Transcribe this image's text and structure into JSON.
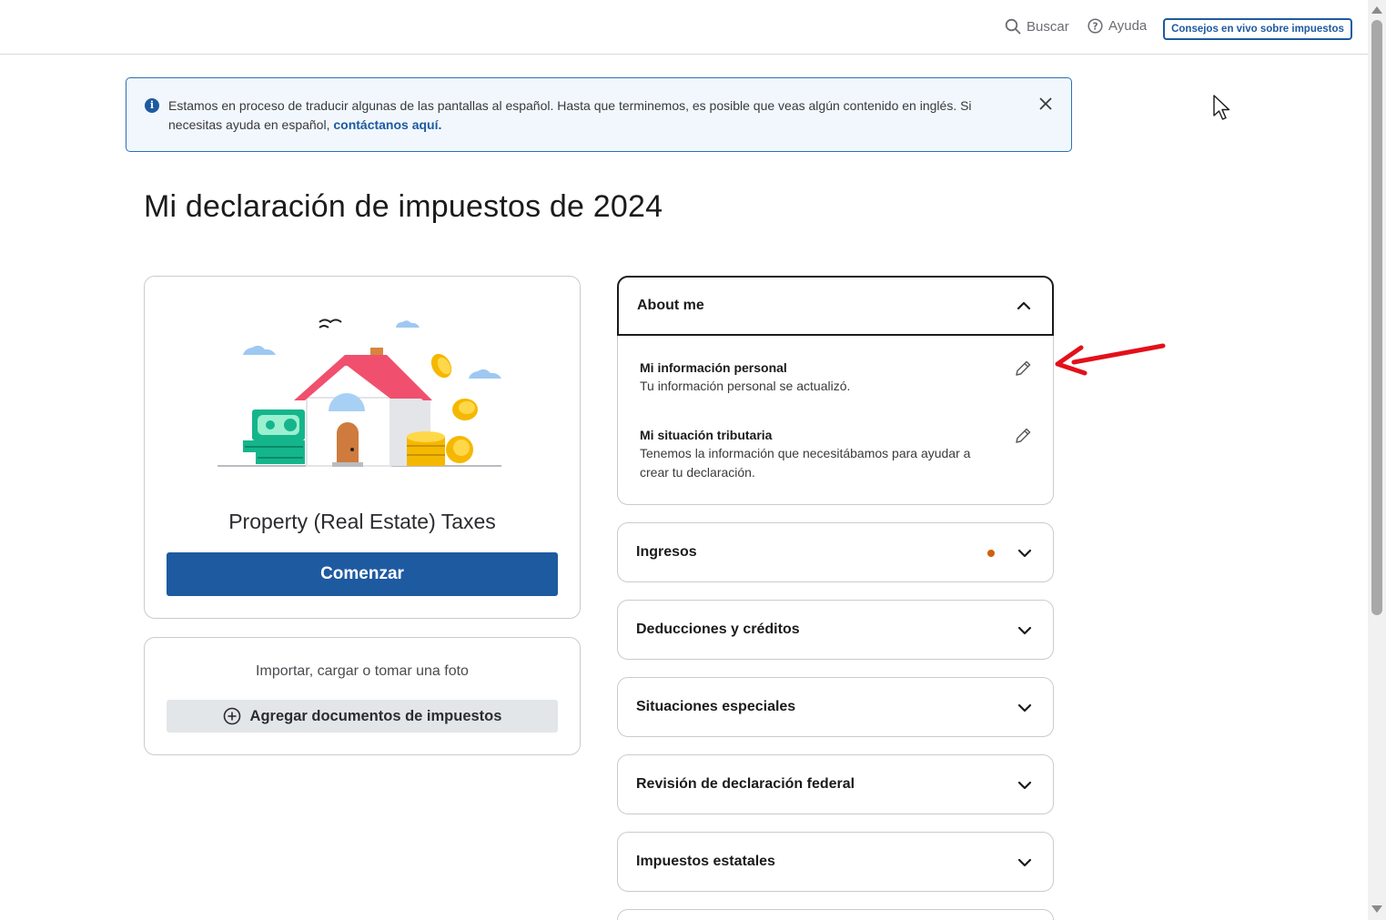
{
  "header": {
    "search_label": "Buscar",
    "help_label": "Ayuda",
    "live_button_label": "Consejos en vivo sobre impuestos"
  },
  "banner": {
    "message": "Estamos en proceso de traducir algunas de las pantallas al español. Hasta que terminemos, es posible que veas algún contenido en inglés. Si necesitas ayuda en español, ",
    "link_text": "contáctanos aquí."
  },
  "page": {
    "title": "Mi declaración de impuestos de 2024"
  },
  "main_card": {
    "title": "Property (Real Estate) Taxes",
    "start_button": "Comenzar"
  },
  "import_card": {
    "label": "Importar, cargar o tomar una foto",
    "add_button": "Agregar documentos de impuestos"
  },
  "about_me": {
    "title": "About me",
    "items": [
      {
        "title": "Mi información personal",
        "desc": "Tu información personal se actualizó."
      },
      {
        "title": "Mi situación tributaria",
        "desc": "Tenemos la información que necesitábamos para ayudar a crear tu declaración."
      }
    ]
  },
  "sections": [
    {
      "label": "Ingresos",
      "has_dot": true
    },
    {
      "label": "Deducciones y créditos"
    },
    {
      "label": "Situaciones especiales"
    },
    {
      "label": "Revisión de declaración federal"
    },
    {
      "label": "Impuestos estatales"
    }
  ],
  "colors": {
    "brand_blue": "#1e5aa0",
    "status_dot": "#d0600e",
    "annotation_arrow": "#e3101a"
  }
}
